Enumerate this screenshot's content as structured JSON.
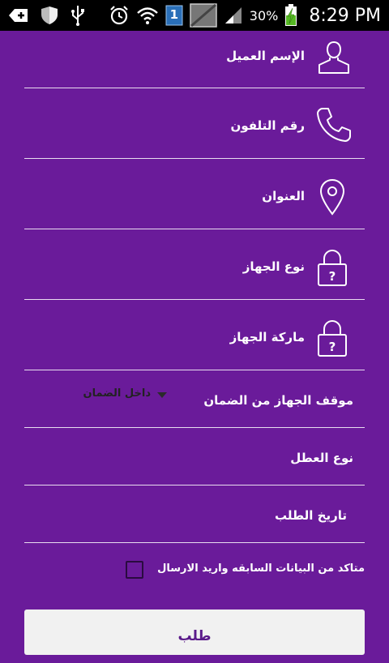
{
  "status_bar": {
    "battery_percent": "30%",
    "time": "8:29 PM",
    "notification_count": "1",
    "icons": [
      "add-icon",
      "shield-icon",
      "usb-icon",
      "alarm-icon",
      "wifi-icon",
      "notification-badge-icon",
      "photo-icon",
      "signal-icon",
      "battery-charging-icon"
    ]
  },
  "form": {
    "fields": [
      {
        "label": "الإسم العميل",
        "icon": "person-icon"
      },
      {
        "label": "رقم التلفون",
        "icon": "phone-icon"
      },
      {
        "label": "العنوان",
        "icon": "location-pin-icon"
      },
      {
        "label": "نوع الجهاز",
        "icon": "lock-icon"
      },
      {
        "label": "ماركة الجهاز",
        "icon": "lock-icon"
      }
    ],
    "warranty": {
      "label": "موقف الجهاز من الضمان",
      "selected": "داخل الضمان"
    },
    "fault_type": {
      "label": "نوع العطل"
    },
    "request_date": {
      "label": "تاريخ الطلب"
    },
    "confirm": {
      "label": "متاكد من البيانات السابقه واريد الارسال",
      "checked": false
    },
    "submit_label": "طلب"
  },
  "colors": {
    "background": "#6a1b9a",
    "status_bar": "#000000",
    "divider": "#ffffff",
    "button_bg": "#f1f1f1",
    "button_text": "#5a1a8a"
  }
}
